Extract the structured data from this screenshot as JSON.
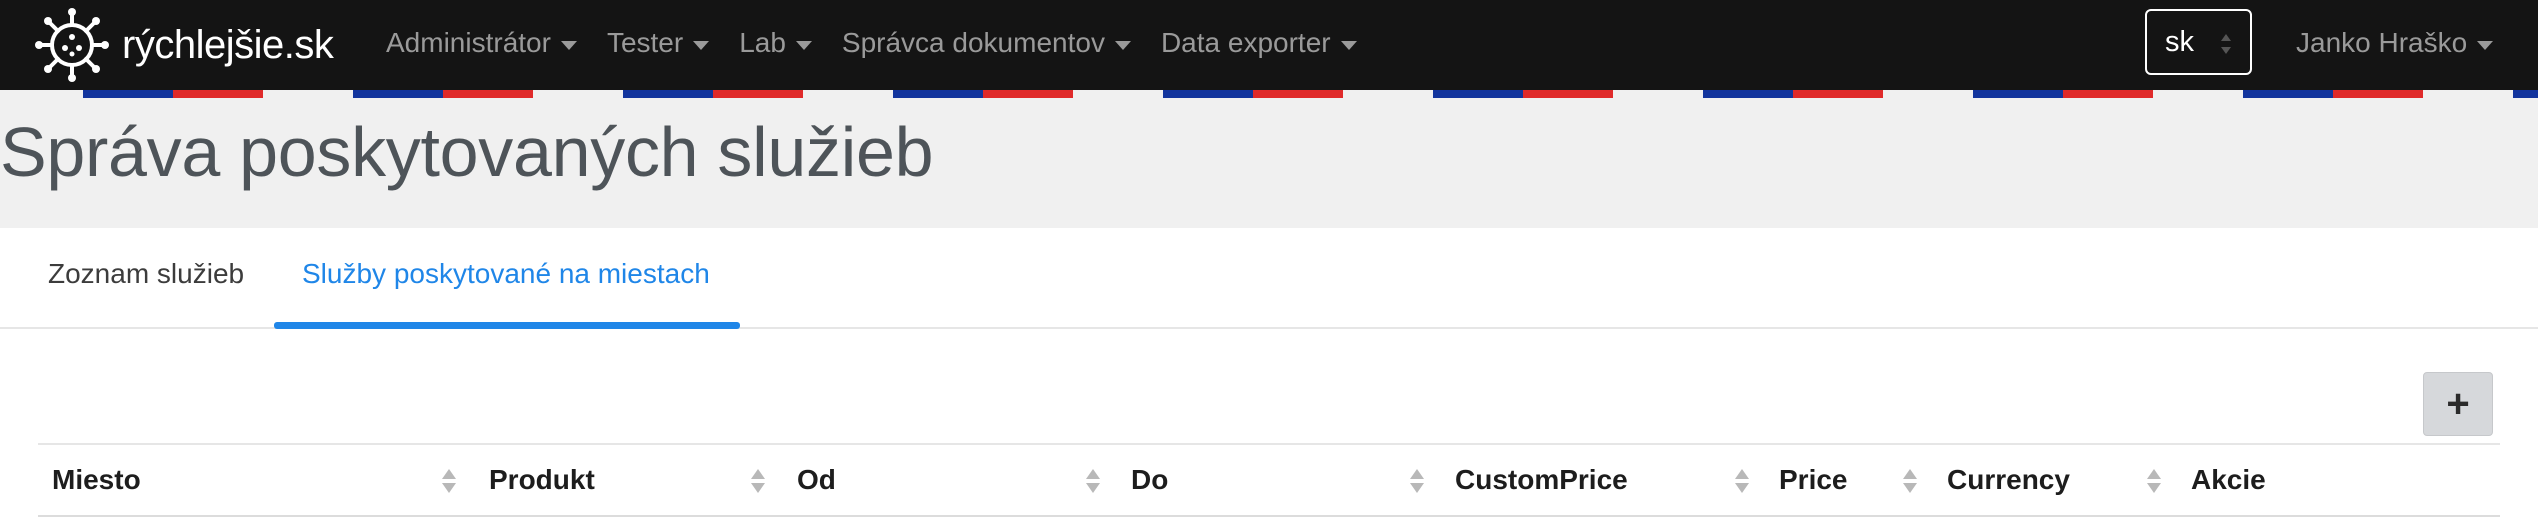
{
  "navbar": {
    "brand": "rýchlejšie.sk",
    "menu": [
      {
        "label": "Administrátor"
      },
      {
        "label": "Tester"
      },
      {
        "label": "Lab"
      },
      {
        "label": "Správca dokumentov"
      },
      {
        "label": "Data exporter"
      }
    ],
    "language": "sk",
    "user": "Janko Hraško"
  },
  "page": {
    "title": "Správa poskytovaných služieb"
  },
  "tabs": [
    {
      "label": "Zoznam služieb",
      "active": false
    },
    {
      "label": "Služby poskytované na miestach",
      "active": true
    }
  ],
  "toolbar": {
    "add_label": "+"
  },
  "table": {
    "columns": [
      "Miesto",
      "Produkt",
      "Od",
      "Do",
      "CustomPrice",
      "Price",
      "Currency",
      "Akcie"
    ]
  },
  "colors": {
    "navbar_bg": "#141414",
    "accent": "#1f86e8",
    "stripe_blue": "#12349d",
    "stripe_red": "#e02a2a"
  },
  "icons": {
    "logo": "virus-logo-icon",
    "dropdown": "caret-down-icon",
    "sort": "sort-icon",
    "add": "plus-icon"
  }
}
